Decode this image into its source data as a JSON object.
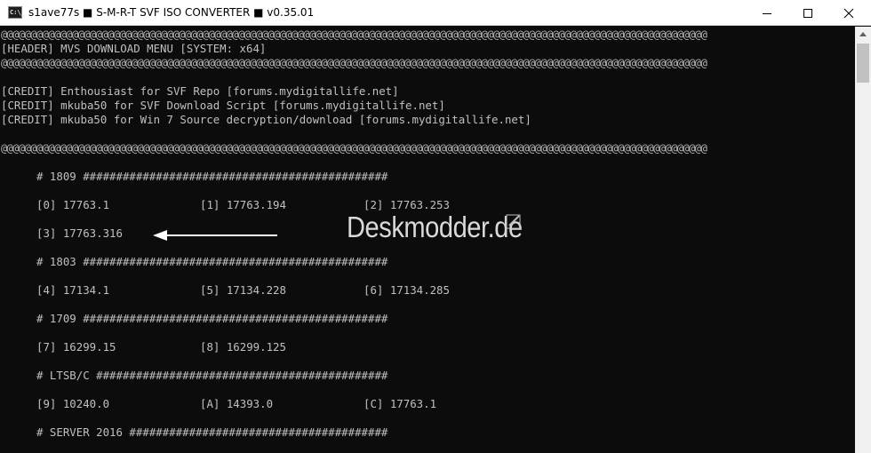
{
  "window": {
    "title": "s1ave77s ■ S-M-R-T SVF ISO CONVERTER ■ v0.35.01",
    "icon_text": "C:\\_",
    "controls": [
      "minimize-icon",
      "maximize-icon",
      "close-icon"
    ]
  },
  "console": {
    "separator": "@@@@@@@@@@@@@@@@@@@@@@@@@@@@@@@@@@@@@@@@@@@@@@@@@@@@@@@@@@@@@@@@@@@@@@@@@@@@@@@@@@@@@@@@@@@@@@@@@@@@@@@@@@@@@@@@@@@@@@@",
    "header": "[HEADER] MVS DOWNLOAD MENU [SYSTEM: x64]",
    "credits": [
      "[CREDIT] Enthousiast for SVF Repo [forums.mydigitallife.net]",
      "[CREDIT] mkuba50 for SVF Download Script [forums.mydigitallife.net]",
      "[CREDIT] mkuba50 for Win 7 Source decryption/download [forums.mydigitallife.net]"
    ],
    "sections": [
      {
        "heading": "# 1809 ##############################################",
        "rows": [
          [
            "[0] 17763.1",
            "[1] 17763.194",
            "[2] 17763.253"
          ],
          [
            "[3] 17763.316"
          ]
        ]
      },
      {
        "heading": "# 1803 ##############################################",
        "rows": [
          [
            "[4] 17134.1",
            "[5] 17134.228",
            "[6] 17134.285"
          ]
        ]
      },
      {
        "heading": "# 1709 ##############################################",
        "rows": [
          [
            "[7] 16299.15",
            "[8] 16299.125"
          ]
        ]
      },
      {
        "heading": "# LTSB/C ############################################",
        "rows": [
          [
            "[9] 10240.0",
            "[A] 14393.0",
            "[C] 17763.1"
          ]
        ]
      },
      {
        "heading": "# SERVER 2016 #######################################",
        "rows": []
      }
    ]
  },
  "overlay": {
    "watermark": "Deskmodder.de",
    "pen_icon": "pen-icon",
    "arrow_icon": "arrow-left-icon",
    "arrow_target": "[3] 17763.316"
  },
  "colors": {
    "console_bg": "#0c0c0c",
    "console_text": "#c0c0c0",
    "titlebar_bg": "#ffffff",
    "watermark": "#d9d9d9"
  }
}
